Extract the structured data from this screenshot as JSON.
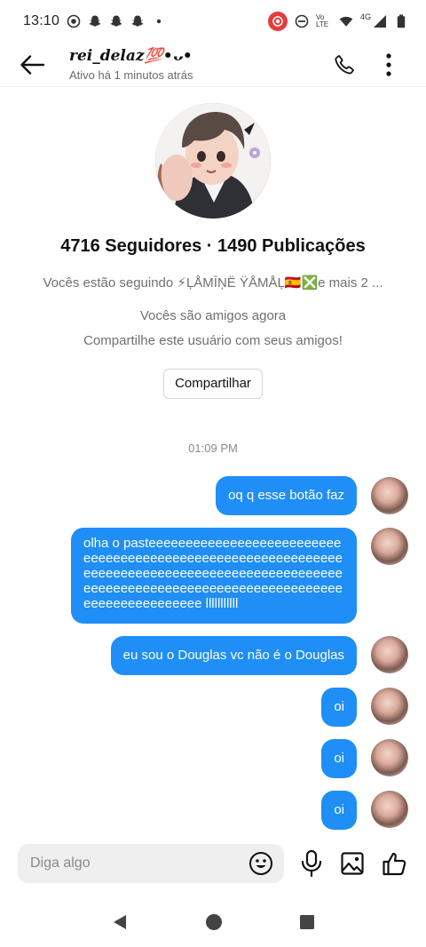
{
  "status_bar": {
    "time": "13:10",
    "network_label": "Vo LTE",
    "signal_label": "4G"
  },
  "header": {
    "contact_name": "rei_delaz💯•ᴗ•",
    "contact_status": "Ativo há 1 minutos atrás"
  },
  "profile": {
    "stats": "4716 Seguidores · 1490 Publicações",
    "following_text": "Vocês estão seguindo ⚡ĻÅMĪŅË ŸÅMÅĻ🇪🇸❎e mais 2 ...",
    "friends_text": "Vocês são amigos agora",
    "share_hint": "Compartilhe este usuário com seus amigos!",
    "share_button": "Compartilhar"
  },
  "conversation": {
    "timestamp": "01:09 PM",
    "messages": [
      {
        "text": "oq q esse botão faz"
      },
      {
        "text": "olha o pasteeeeeeeeeeeeeeeeeeeeeeeeeeeeeeeeeeeeeeeeeeeeeeeeeeeeeeeeeeeeeeeeeeeeeeeeeeeeeeeeeeeeeeeeeeeeeeeeeeeeeeeeeeeeeeeeeeeeeeeeeeeeeeeeeeeeeeeeeeeeeeeeeee lllllllllll"
      },
      {
        "text": "eu sou o Douglas vc não é o Douglas"
      },
      {
        "text": "oi"
      },
      {
        "text": "oi"
      },
      {
        "text": "oi"
      }
    ]
  },
  "composer": {
    "placeholder": "Diga algo"
  },
  "colors": {
    "bubble": "#1f8ef7",
    "bubble_text": "#ffffff",
    "composer_bg": "#efefef",
    "muted_text": "#707070"
  }
}
